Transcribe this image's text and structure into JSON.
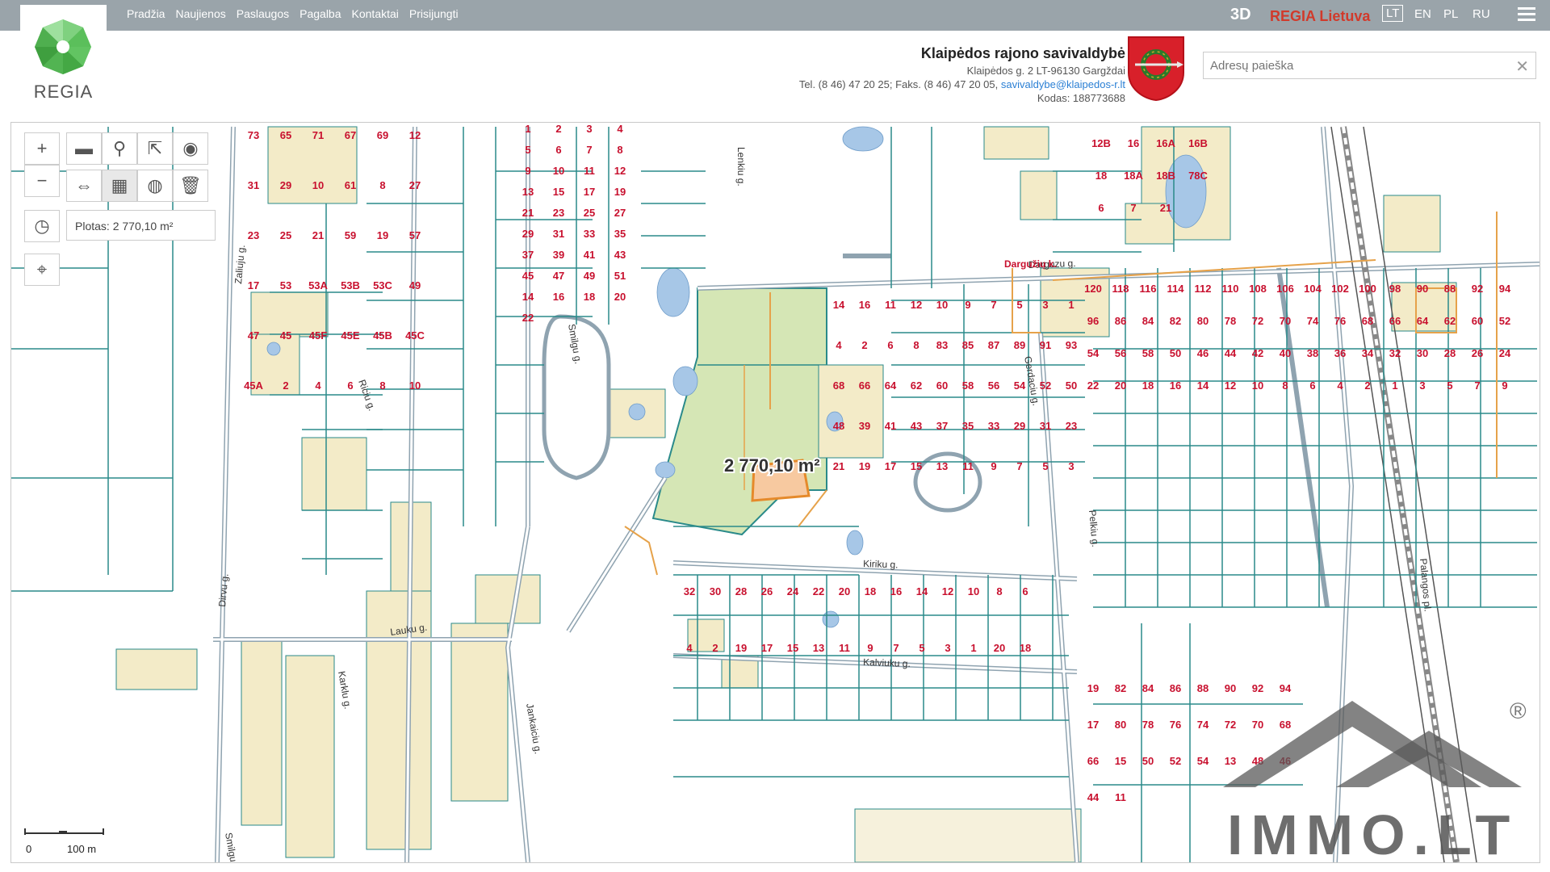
{
  "nav": [
    "Pradžia",
    "Naujienos",
    "Paslaugos",
    "Pagalba",
    "Kontaktai",
    "Prisijungti"
  ],
  "brand": {
    "logo_text": "REGIA"
  },
  "header": {
    "btn_3d": "3D",
    "regia_lietuva": "REGIA Lietuva",
    "languages": [
      "LT",
      "EN",
      "PL",
      "RU"
    ]
  },
  "municipality": {
    "title": "Klaipėdos rajono savivaldybė",
    "address": "Klaipėdos g. 2 LT-96130 Gargždai",
    "phone": "Tel. (8 46) 47 20 25; Faks. (8 46) 47 20 05,",
    "email": "savivaldybe@klaipedos-r.lt",
    "code": "Kodas: 188773688"
  },
  "search": {
    "placeholder": "Adresų paieška"
  },
  "tools": {
    "area_readout": "Plotas: 2 770,10 m²"
  },
  "map_labels": {
    "selection": "2 770,10 m²",
    "village": "Dargužių k.",
    "streets": [
      "Kiriku g.",
      "Kalviuku g.",
      "Lauku g.",
      "Karklu g.",
      "Jankaiciu g.",
      "Smilgu g.",
      "Riciu g.",
      "Zaliuju g.",
      "Dirvu g.",
      "Smilgu g.",
      "Darguzu g.",
      "Gerdaciu g.",
      "Lenkiu g.",
      "Palangos pl.",
      "Pelkiu g."
    ],
    "parcels_block_a": [
      "73",
      "65",
      "71",
      "67",
      "69",
      "12",
      "31",
      "29",
      "10",
      "61",
      "8",
      "27",
      "23",
      "25",
      "21",
      "59",
      "19",
      "57",
      "17",
      "53",
      "53A",
      "53B",
      "53C",
      "49",
      "47",
      "45",
      "45F",
      "45E",
      "45B",
      "45C",
      "45A",
      "2",
      "4",
      "6",
      "8",
      "10"
    ],
    "parcels_block_b": [
      "1",
      "2",
      "3",
      "4",
      "5",
      "6",
      "7",
      "8",
      "9",
      "10",
      "11",
      "12",
      "13",
      "15",
      "17",
      "19",
      "21",
      "23",
      "25",
      "27",
      "29",
      "31",
      "33",
      "35",
      "37",
      "39",
      "41",
      "43",
      "45",
      "47",
      "49",
      "51",
      "14",
      "16",
      "18",
      "20",
      "22"
    ],
    "parcels_block_c": [
      "14",
      "16",
      "11",
      "12",
      "10",
      "9",
      "7",
      "5",
      "3",
      "1",
      "4",
      "2",
      "6",
      "8",
      "83",
      "85",
      "87",
      "89",
      "91",
      "93",
      "68",
      "66",
      "64",
      "62",
      "60",
      "58",
      "56",
      "54",
      "52",
      "50",
      "48",
      "39",
      "41",
      "43",
      "37",
      "35",
      "33",
      "29",
      "31",
      "23",
      "21",
      "19",
      "17",
      "15",
      "13",
      "11",
      "9",
      "7",
      "5",
      "3"
    ],
    "parcels_block_d": [
      "32",
      "30",
      "28",
      "26",
      "24",
      "22",
      "20",
      "18",
      "16",
      "14",
      "12",
      "10",
      "8",
      "6",
      "4",
      "2",
      "19",
      "17",
      "15",
      "13",
      "11",
      "9",
      "7",
      "5",
      "3",
      "1",
      "20",
      "18"
    ],
    "parcels_block_e": [
      "120",
      "118",
      "116",
      "114",
      "112",
      "110",
      "108",
      "106",
      "104",
      "102",
      "100",
      "98",
      "90",
      "88",
      "92",
      "94",
      "96",
      "86",
      "84",
      "82",
      "80",
      "78",
      "72",
      "70",
      "74",
      "76",
      "68",
      "66",
      "64",
      "62",
      "60",
      "52",
      "54",
      "56",
      "58",
      "50",
      "46",
      "44",
      "42",
      "40",
      "38",
      "36",
      "34",
      "32",
      "30",
      "28",
      "26",
      "24",
      "22",
      "20",
      "18",
      "16",
      "14",
      "12",
      "10",
      "8",
      "6",
      "4",
      "2",
      "1",
      "3",
      "5",
      "7",
      "9"
    ],
    "parcels_block_f": [
      "19",
      "82",
      "84",
      "86",
      "88",
      "90",
      "92",
      "94",
      "17",
      "80",
      "78",
      "76",
      "74",
      "72",
      "70",
      "68",
      "66",
      "15",
      "50",
      "52",
      "54",
      "13",
      "48",
      "46",
      "44",
      "11"
    ],
    "parcels_misc": [
      "12B",
      "16",
      "16A",
      "16B",
      "18",
      "18A",
      "18B",
      "78C",
      "6",
      "7",
      "21"
    ]
  },
  "scale": {
    "zero": "0",
    "distance": "100 m"
  },
  "watermark": {
    "text": "IMMO.LT",
    "registered": "®"
  },
  "colors": {
    "topbar": "#9aa4aa",
    "parcel_line": "#2a8a8a",
    "parcel_label": "#c8102e",
    "forest": "#d5e6b5",
    "built": "#f3ebc8",
    "selection": "#f7c9a0",
    "road": "#8fa3b0"
  }
}
